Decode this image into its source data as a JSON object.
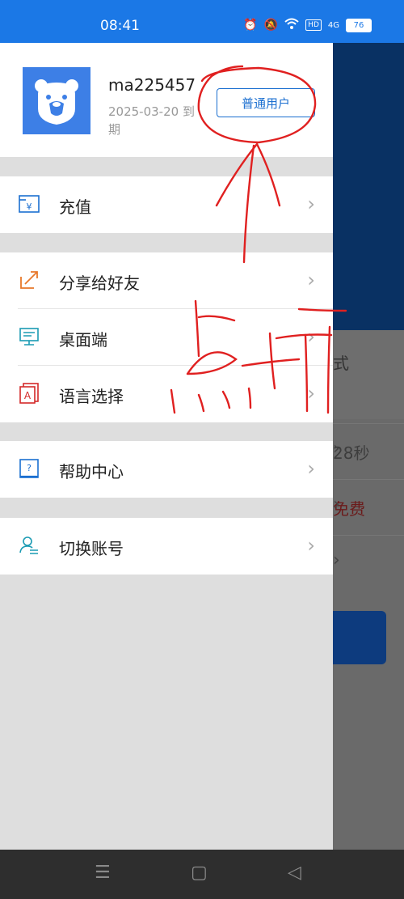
{
  "status_bar": {
    "time": "08:41",
    "network": "4G",
    "hd": "HD",
    "battery": "76"
  },
  "profile": {
    "username": "ma225457",
    "expire_text": "2025-03-20 到期",
    "user_level": "普通用户"
  },
  "menu": [
    {
      "label": "充值",
      "icon": "recharge-icon"
    },
    {
      "label": "分享给好友",
      "icon": "share-icon"
    },
    {
      "label": "桌面端",
      "icon": "desktop-icon"
    },
    {
      "label": "语言选择",
      "icon": "language-icon"
    },
    {
      "label": "帮助中心",
      "icon": "help-icon"
    },
    {
      "label": "切换账号",
      "icon": "switch-account-icon"
    }
  ],
  "background_app": {
    "row1_text": "式",
    "row2_text": "28秒",
    "row3_text": "免费"
  },
  "annotation": {
    "text": "点中",
    "color": "#e02020"
  },
  "colors": {
    "accent": "#1b78e6",
    "link_blue": "#1b6fd0",
    "annotation_red": "#e02020"
  }
}
